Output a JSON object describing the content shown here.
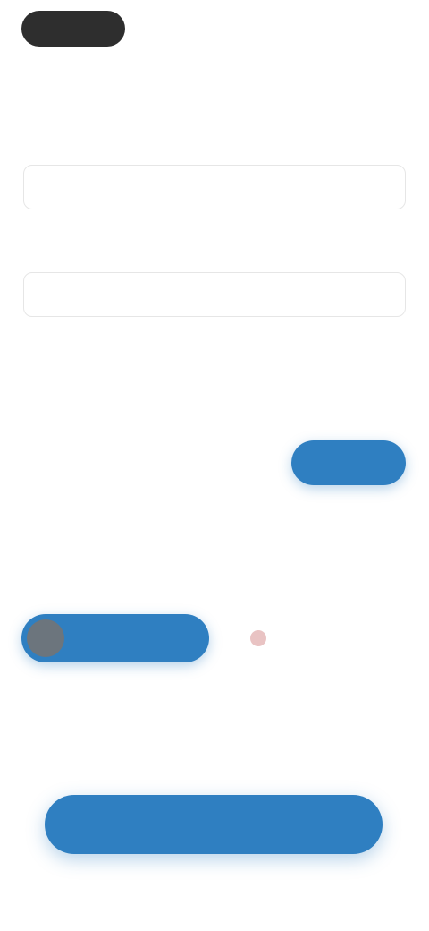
{
  "header": {
    "back_label": "",
    "right_text": ""
  },
  "page": {
    "title": ""
  },
  "fields": [
    {
      "label": "",
      "value": ""
    },
    {
      "label": "",
      "value": ""
    }
  ],
  "grid": {
    "label": "",
    "rows": [
      [
        "",
        ""
      ],
      [
        "",
        ""
      ],
      [
        "",
        ""
      ]
    ]
  },
  "side_button": {
    "label": ""
  },
  "toggle_section": {
    "label": "",
    "toggle_label": "",
    "alert_text": ""
  },
  "primary_button": {
    "label": ""
  },
  "colors": {
    "accent": "#2f7fc1",
    "dark": "#2e2e2e",
    "alert": "#e9c3c3"
  }
}
